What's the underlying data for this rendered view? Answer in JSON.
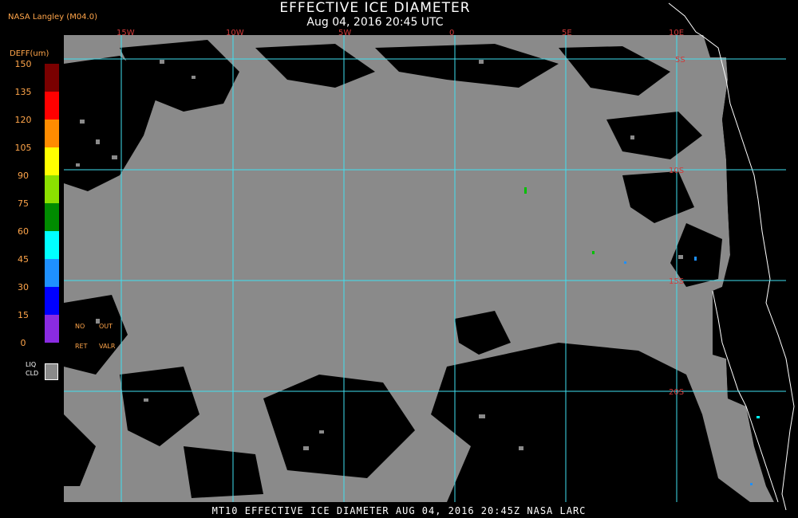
{
  "header": {
    "title": "EFFECTIVE ICE DIAMETER",
    "subtitle": "Aug 04, 2016 20:45 UTC",
    "credit": "NASA Langley (M04.0)"
  },
  "legend": {
    "title": "DEFF(um)",
    "tick_labels": [
      "150",
      "135",
      "120",
      "105",
      "90",
      "75",
      "60",
      "45",
      "30",
      "15",
      "0"
    ],
    "colors": [
      "#7a0000",
      "#ff0000",
      "#ff8c00",
      "#ffff00",
      "#8ce000",
      "#008c00",
      "#00ffff",
      "#1e90ff",
      "#0000ff",
      "#8a2be2"
    ],
    "no_ret_labels": {
      "no": "NO",
      "out": "OUT",
      "ret": "RET",
      "valr": "VALR"
    },
    "liquid_cloud": {
      "line1": "LIQ",
      "line2": "CLD",
      "color": "#8a8a8a"
    }
  },
  "map": {
    "longitude_labels": [
      "15W",
      "10W",
      "5W",
      "0",
      "5E",
      "10E"
    ],
    "latitude_labels": [
      "5S",
      "10S",
      "15S",
      "20S"
    ],
    "grid_color": "#40e0f0",
    "coast_color": "#ffffff"
  },
  "footer": {
    "caption": "MT10  EFFECTIVE ICE DIAMETER   AUG 04, 2016 20:45Z   NASA LARC"
  }
}
